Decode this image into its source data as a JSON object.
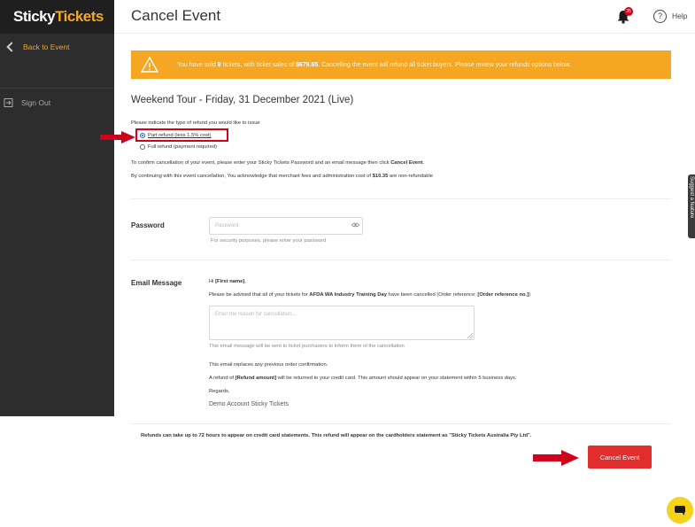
{
  "app": {
    "logo_sticky": "Sticky",
    "logo_tickets": "Tickets"
  },
  "sidebar": {
    "back_label": "Back to Event",
    "signout_label": "Sign Out"
  },
  "header": {
    "title": "Cancel Event",
    "notification_count": "35",
    "help_label": "Help"
  },
  "alert": {
    "prefix": "You have sold ",
    "tickets_sold": "9",
    "middle": " tickets, with ticket sales of ",
    "sales_amount": "$679.65",
    "suffix": ". Cancelling the event will refund all ticket buyers. Please review your refunds options below."
  },
  "event": {
    "title": "Weekend Tour - Friday, 31 December 2021 (Live)"
  },
  "refund": {
    "prompt": "Please indicate the type of refund you would like to issue",
    "options": [
      {
        "label": "Part refund (less 1.5% cost)",
        "selected": true
      },
      {
        "label": "Full refund (payment required)",
        "selected": false
      }
    ],
    "confirm_prefix": "To confirm cancellation of your event, please enter your Sticky Tickets Password and an email message then click ",
    "confirm_bold": "Cancel Event",
    "confirm_suffix": ".",
    "ack_prefix": "By continuing with this event cancellation, You acknowledge that merchant fees and administration cost of ",
    "ack_amount": "$10.35",
    "ack_suffix": " are non-refundable"
  },
  "password": {
    "label": "Password",
    "placeholder": "Password",
    "hint": "For security purposes, please enter your password"
  },
  "email": {
    "label": "Email Message",
    "greeting_prefix": "Hi ",
    "greeting_token": "[First name]",
    "greeting_suffix": ",",
    "advice_prefix": "Please be advised that all of your tickets for ",
    "advice_event": "AFDA WA Industry Training Day",
    "advice_middle": " have been cancelled (Order reference: ",
    "advice_token": "[Order reference no.]",
    "advice_suffix": ")",
    "textarea_placeholder": "Enter the reason for cancellation...",
    "hint": "This email message will be sent to ticket purchasers to inform them of the cancellation",
    "replaces": "This email replaces any previous order confirmation.",
    "refund_prefix": "A refund of ",
    "refund_token": "[Refund amount]",
    "refund_suffix": " will be returned to your credit card. This amount should appear on your statement within 5 business days.",
    "regards": "Regards,",
    "signature": "Demo Account Sticky Tickets"
  },
  "footer": {
    "note": "Refunds can take up to 72 hours to appear on credit card statements. This refund will appear on the cardholders statement as \"Sticky Tickets Australia Pty Ltd\"."
  },
  "actions": {
    "cancel_label": "Cancel Event"
  },
  "widgets": {
    "suggest_label": "Suggest a feature"
  },
  "colors": {
    "brand_orange": "#f5a623",
    "danger_red": "#e22d2d",
    "sidebar_bg": "#2d2d2d"
  }
}
